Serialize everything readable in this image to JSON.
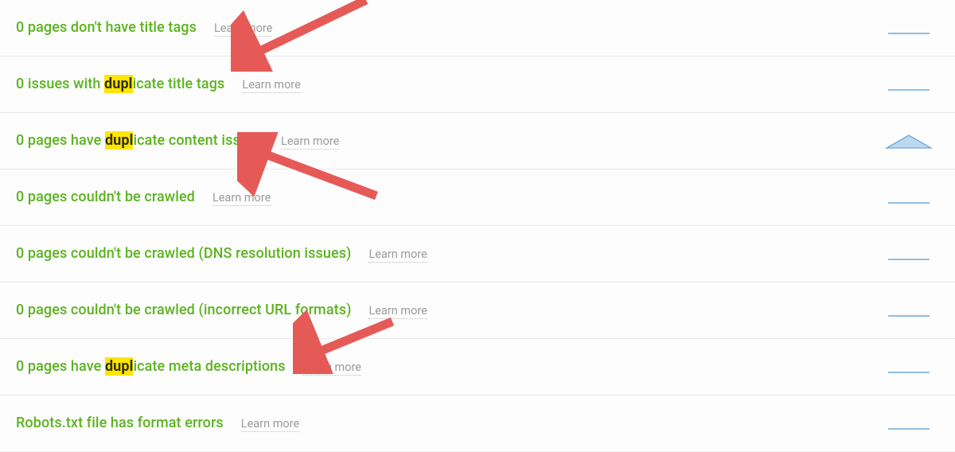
{
  "highlight": "dupl",
  "learn_more": "Learn more",
  "rows": [
    {
      "count": "0",
      "pre": " pages don't have title tags",
      "hl": false,
      "post": "",
      "spark": "line"
    },
    {
      "count": "0",
      "pre": " issues with ",
      "hl": true,
      "post": "icate title tags",
      "spark": "line"
    },
    {
      "count": "0",
      "pre": " pages have ",
      "hl": true,
      "post": "icate content issues",
      "spark": "area"
    },
    {
      "count": "0",
      "pre": " pages couldn't be crawled",
      "hl": false,
      "post": "",
      "spark": "line"
    },
    {
      "count": "0",
      "pre": " pages couldn't be crawled (DNS resolution issues)",
      "hl": false,
      "post": "",
      "spark": "line"
    },
    {
      "count": "0",
      "pre": " pages couldn't be crawled (incorrect URL formats)",
      "hl": false,
      "post": "",
      "spark": "line"
    },
    {
      "count": "0",
      "pre": " pages have ",
      "hl": true,
      "post": "icate meta descriptions",
      "spark": "line"
    },
    {
      "count": "Robots.txt file has format errors",
      "pre": "",
      "hl": false,
      "post": "",
      "spark": "line",
      "freeform": true
    }
  ]
}
